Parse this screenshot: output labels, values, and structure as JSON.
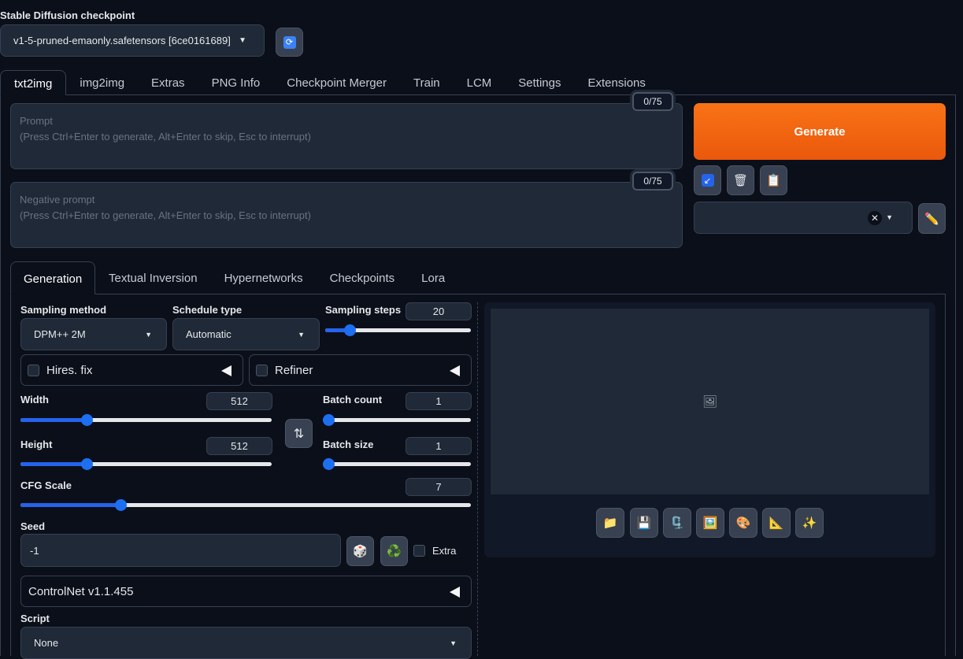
{
  "checkpoint": {
    "label": "Stable Diffusion checkpoint",
    "value": "v1-5-pruned-emaonly.safetensors [6ce0161689]"
  },
  "top_tabs": [
    "txt2img",
    "img2img",
    "Extras",
    "PNG Info",
    "Checkpoint Merger",
    "Train",
    "LCM",
    "Settings",
    "Extensions"
  ],
  "prompt": {
    "placeholder_title": "Prompt",
    "placeholder_hint": "(Press Ctrl+Enter to generate, Alt+Enter to skip, Esc to interrupt)",
    "token_count": "0/75"
  },
  "negative_prompt": {
    "placeholder_title": "Negative prompt",
    "placeholder_hint": "(Press Ctrl+Enter to generate, Alt+Enter to skip, Esc to interrupt)",
    "token_count": "0/75"
  },
  "generate_label": "Generate",
  "tool_icons": [
    "↙",
    "🗑",
    "📋"
  ],
  "style_clear_icon": "✕",
  "edit_icon": "✏️",
  "sub_tabs": [
    "Generation",
    "Textual Inversion",
    "Hypernetworks",
    "Checkpoints",
    "Lora"
  ],
  "sampling_method": {
    "label": "Sampling method",
    "value": "DPM++ 2M"
  },
  "schedule_type": {
    "label": "Schedule type",
    "value": "Automatic"
  },
  "sampling_steps": {
    "label": "Sampling steps",
    "value": "20",
    "fraction": 0.13
  },
  "hires_fix": {
    "label": "Hires. fix"
  },
  "refiner": {
    "label": "Refiner"
  },
  "width": {
    "label": "Width",
    "value": "512",
    "fraction": 0.24
  },
  "height": {
    "label": "Height",
    "value": "512",
    "fraction": 0.24
  },
  "batch_count": {
    "label": "Batch count",
    "value": "1",
    "fraction": 0
  },
  "batch_size": {
    "label": "Batch size",
    "value": "1",
    "fraction": 0
  },
  "swap_icon": "⇅",
  "cfg_scale": {
    "label": "CFG Scale",
    "value": "7",
    "fraction": 0.21
  },
  "seed": {
    "label": "Seed",
    "value": "-1",
    "extra_label": "Extra"
  },
  "seed_icons": {
    "dice": "🎲",
    "recycle": "♻️"
  },
  "controlnet_label": "ControlNet v1.1.455",
  "script": {
    "label": "Script",
    "value": "None"
  },
  "gallery_icon": "🖼",
  "output_icons": [
    "📁",
    "💾",
    "🗜️",
    "🖼️",
    "🎨",
    "📐",
    "✨"
  ]
}
